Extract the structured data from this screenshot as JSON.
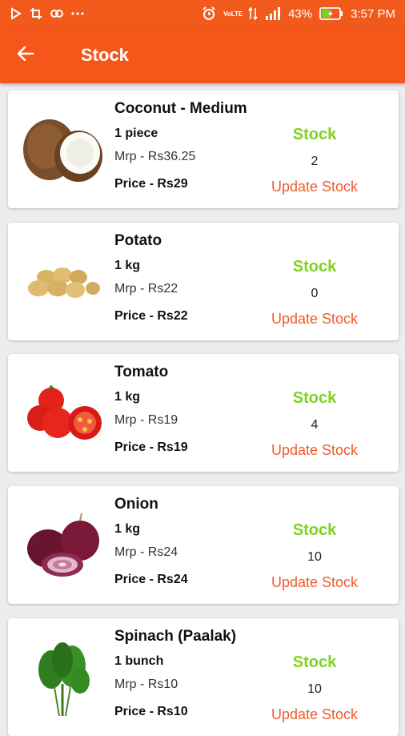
{
  "status_bar": {
    "battery": "43%",
    "time": "3:57 PM",
    "network_label": "VoLTE"
  },
  "header": {
    "title": "Stock"
  },
  "products": [
    {
      "name": "Coconut - Medium",
      "quantity": "1 piece",
      "mrp": "Mrp - Rs36.25",
      "price": "Price - Rs29",
      "stock_label": "Stock",
      "stock": "2",
      "update_label": "Update Stock",
      "image_icon": "coconut"
    },
    {
      "name": "Potato",
      "quantity": "1 kg",
      "mrp": "Mrp - Rs22",
      "price": "Price - Rs22",
      "stock_label": "Stock",
      "stock": "0",
      "update_label": "Update Stock",
      "image_icon": "potato"
    },
    {
      "name": "Tomato",
      "quantity": "1 kg",
      "mrp": "Mrp - Rs19",
      "price": "Price - Rs19",
      "stock_label": "Stock",
      "stock": "4",
      "update_label": "Update Stock",
      "image_icon": "tomato"
    },
    {
      "name": "Onion",
      "quantity": "1 kg",
      "mrp": "Mrp - Rs24",
      "price": "Price - Rs24",
      "stock_label": "Stock",
      "stock": "10",
      "update_label": "Update Stock",
      "image_icon": "onion"
    },
    {
      "name": "Spinach (Paalak)",
      "quantity": "1 bunch",
      "mrp": "Mrp - Rs10",
      "price": "Price - Rs10",
      "stock_label": "Stock",
      "stock": "10",
      "update_label": "Update Stock",
      "image_icon": "spinach"
    }
  ],
  "colors": {
    "primary": "#f5561a",
    "stock_green": "#7ed321",
    "update_orange": "#f05a2a"
  }
}
